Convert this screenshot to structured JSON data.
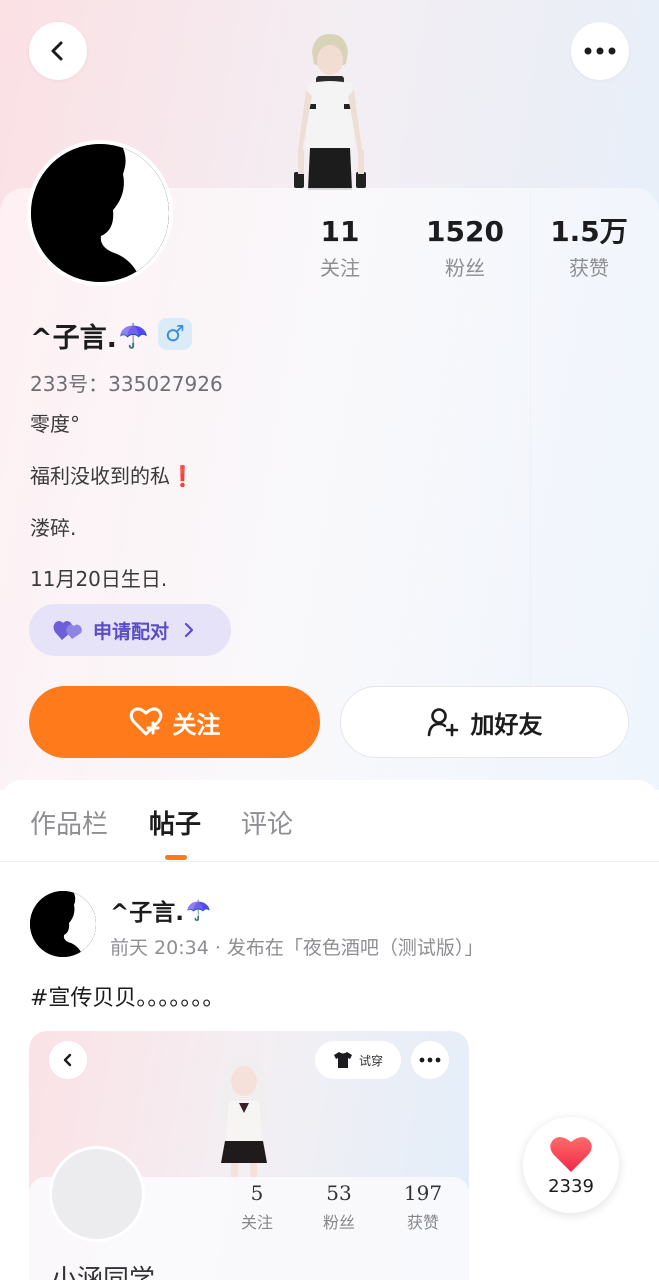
{
  "header": {
    "back_icon": "chevron-left-icon",
    "more_icon": "more-dots-icon"
  },
  "stats": [
    {
      "value": "11",
      "label": "关注"
    },
    {
      "value": "1520",
      "label": "粉丝"
    },
    {
      "value": "1.5万",
      "label": "获赞"
    }
  ],
  "profile": {
    "name": "^子言.",
    "name_emoji": "☂️",
    "gender_symbol": "♂",
    "uid": "233号：335027926",
    "bio": [
      "零度°",
      "福利没收到的私❗",
      "溇碎.",
      "11月20日生日."
    ],
    "pair_label": "申请配对",
    "follow_label": "关注",
    "add_friend_label": "加好友"
  },
  "tabs": [
    {
      "label": "作品栏",
      "active": false
    },
    {
      "label": "帖子",
      "active": true
    },
    {
      "label": "评论",
      "active": false
    }
  ],
  "post": {
    "author": "^子言.",
    "author_emoji": "☂️",
    "meta": "前天 20:34 · 发布在「夜色酒吧（测试版）」",
    "text": "#宣传贝贝。。。。。。。",
    "image": {
      "tryon_label": "试穿",
      "stats": [
        {
          "value": "5",
          "label": "关注"
        },
        {
          "value": "53",
          "label": "粉丝"
        },
        {
          "value": "197",
          "label": "获赞"
        }
      ],
      "name": "小涵同学"
    }
  },
  "like": {
    "count": "2339"
  },
  "colors": {
    "accent": "#ff7a1a",
    "pair_purple": "#5b4dc4",
    "gender_blue": "#3a8fd6"
  }
}
